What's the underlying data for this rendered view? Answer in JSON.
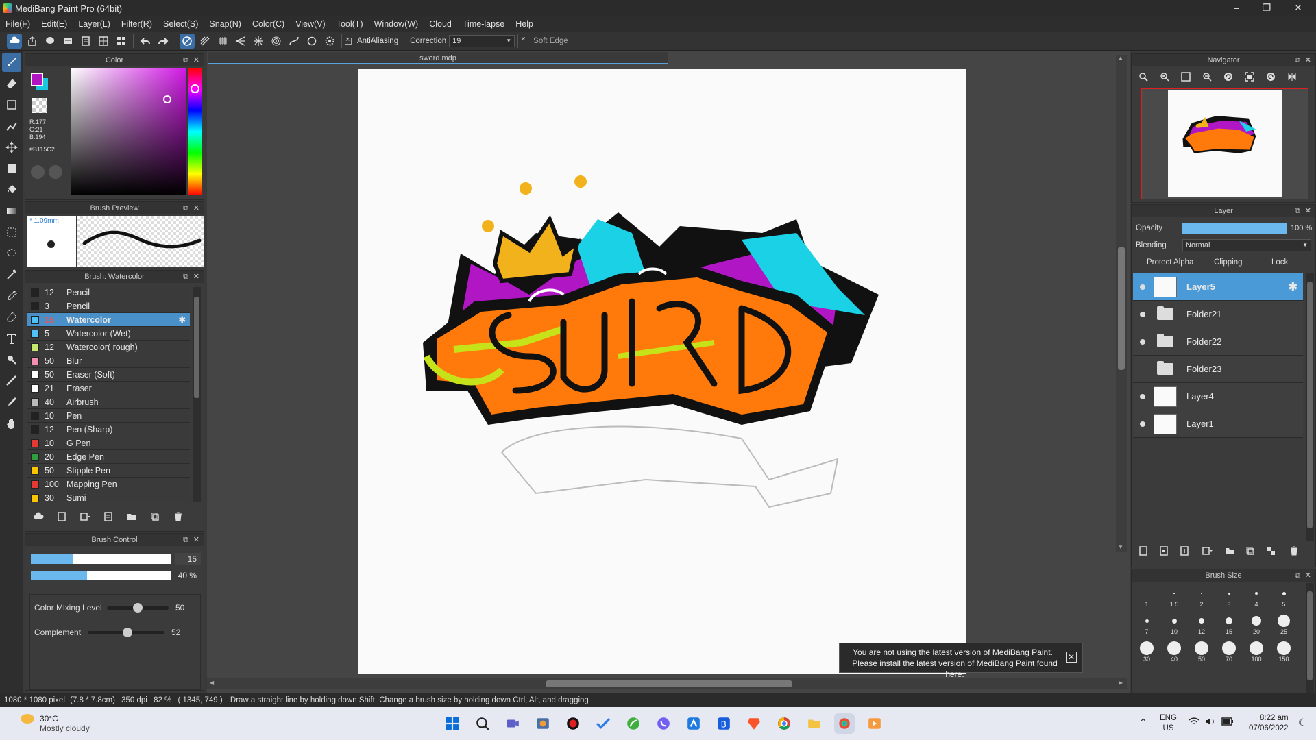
{
  "window": {
    "title": "MediBang Paint Pro (64bit)",
    "minimize": "–",
    "maximize": "❐",
    "close": "✕"
  },
  "menu": [
    "File(F)",
    "Edit(E)",
    "Layer(L)",
    "Filter(R)",
    "Select(S)",
    "Snap(N)",
    "Color(C)",
    "View(V)",
    "Tool(T)",
    "Window(W)",
    "Cloud",
    "Time-lapse",
    "Help"
  ],
  "toolbar": {
    "antialiasing": "AntiAliasing",
    "correction_label": "Correction",
    "correction_value": "19",
    "soft_edge": "Soft Edge"
  },
  "color_panel": {
    "title": "Color",
    "r": "R:177",
    "g": "G:21",
    "b": "B:194",
    "hex": "#B115C2",
    "primary": "#B115C2",
    "secondary": "#18C8E0"
  },
  "brush_preview": {
    "title": "Brush Preview",
    "size": "* 1.09mm"
  },
  "brush_list": {
    "title": "Brush: Watercolor",
    "items": [
      {
        "size": "12",
        "name": "Pencil",
        "color": "#222222"
      },
      {
        "size": "3",
        "name": "Pencil",
        "color": "#222222"
      },
      {
        "size": "15",
        "name": "Watercolor",
        "color": "#4fc3f7"
      },
      {
        "size": "5",
        "name": "Watercolor (Wet)",
        "color": "#4fc3f7"
      },
      {
        "size": "12",
        "name": "Watercolor( rough)",
        "color": "#c5e86c"
      },
      {
        "size": "50",
        "name": "Blur",
        "color": "#f48fb1"
      },
      {
        "size": "50",
        "name": "Eraser (Soft)",
        "color": "#ffffff"
      },
      {
        "size": "21",
        "name": "Eraser",
        "color": "#ffffff"
      },
      {
        "size": "40",
        "name": "Airbrush",
        "color": "#bbbbbb"
      },
      {
        "size": "10",
        "name": "Pen",
        "color": "#222222"
      },
      {
        "size": "12",
        "name": "Pen (Sharp)",
        "color": "#222222"
      },
      {
        "size": "10",
        "name": "G Pen",
        "color": "#e53935"
      },
      {
        "size": "20",
        "name": "Edge Pen",
        "color": "#2e9e3e"
      },
      {
        "size": "50",
        "name": "Stipple Pen",
        "color": "#f9c400"
      },
      {
        "size": "100",
        "name": "Mapping Pen",
        "color": "#e53935"
      },
      {
        "size": "30",
        "name": "Sumi",
        "color": "#f9c400"
      }
    ]
  },
  "brush_control": {
    "title": "Brush Control",
    "size_value": "15",
    "size_fraction": 0.3,
    "opacity_value": "40 %",
    "opacity_fraction": 0.4,
    "mixing_label": "Color Mixing Level",
    "mixing_value": "50",
    "mixing_fraction": 0.5,
    "complement_label": "Complement",
    "complement_value": "52",
    "complement_fraction": 0.52
  },
  "canvas": {
    "tab": "sword.mdp"
  },
  "navigator": {
    "title": "Navigator"
  },
  "layer_panel": {
    "title": "Layer",
    "opacity_label": "Opacity",
    "opacity_value": "100 %",
    "blending_label": "Blending",
    "blending_value": "Normal",
    "protect_alpha": "Protect Alpha",
    "clipping": "Clipping",
    "lock": "Lock",
    "layers": [
      {
        "name": "Layer5",
        "type": "layer",
        "visible": true,
        "selected": true
      },
      {
        "name": "Folder21",
        "type": "folder",
        "visible": true
      },
      {
        "name": "Folder22",
        "type": "folder",
        "visible": true
      },
      {
        "name": "Folder23",
        "type": "folder",
        "visible": false
      },
      {
        "name": "Layer4",
        "type": "layer",
        "visible": true
      },
      {
        "name": "Layer1",
        "type": "layer",
        "visible": true
      }
    ]
  },
  "brush_size": {
    "title": "Brush Size",
    "sizes": [
      "1",
      "1.5",
      "2",
      "3",
      "4",
      "5",
      "7",
      "10",
      "12",
      "15",
      "20",
      "25",
      "30",
      "40",
      "50",
      "70",
      "100",
      "150"
    ]
  },
  "notification": {
    "line1": "You are not using the latest version of MediBang Paint.",
    "line2": "Please install the latest version of MediBang Paint found here."
  },
  "status": {
    "dims": "1080 * 1080 pixel",
    "cm": "(7.8 * 7.8cm)",
    "dpi": "350 dpi",
    "zoom": "82 %",
    "coords": "( 1345, 749 )",
    "hint": "Draw a straight line by holding down Shift, Change a brush size by holding down Ctrl, Alt, and dragging"
  },
  "taskbar": {
    "temp": "30°C",
    "weather": "Mostly cloudy",
    "lang1": "ENG",
    "lang2": "US",
    "time": "8:22 am",
    "date": "07/06/2022"
  }
}
